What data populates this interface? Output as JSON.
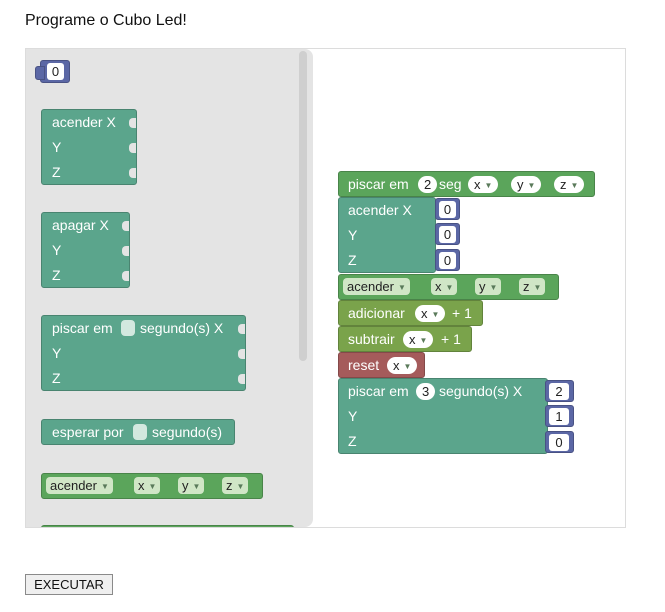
{
  "page": {
    "title": "Programe o Cubo Led!"
  },
  "flyout": {
    "number": "0",
    "acender": {
      "line1": "acender X",
      "line2": "Y",
      "line3": "Z"
    },
    "apagar": {
      "line1": "apagar X",
      "line2": "Y",
      "line3": "Z"
    },
    "piscar": {
      "pre": "piscar em",
      "post": "segundo(s) X",
      "line2": "Y",
      "line3": "Z"
    },
    "esperar": {
      "pre": "esperar por",
      "post": "segundo(s)"
    },
    "acender_dd": {
      "label": "acender",
      "x": "x",
      "y": "y",
      "z": "z"
    }
  },
  "canvas": {
    "piscar_seg": {
      "pre": "piscar em",
      "num": "2",
      "post": "seg",
      "x": "x",
      "y": "y",
      "z": "z"
    },
    "acender": {
      "line1": "acender X",
      "line2": "Y",
      "line3": "Z",
      "x": "0",
      "y": "0",
      "z": "0"
    },
    "acender_dd": {
      "label": "acender",
      "x": "x",
      "y": "y",
      "z": "z"
    },
    "adicionar": {
      "label": "adicionar",
      "var": "x",
      "suffix": "+ 1"
    },
    "subtrair": {
      "label": "subtrair",
      "var": "x",
      "suffix": "+ 1"
    },
    "reset": {
      "label": "reset",
      "var": "x"
    },
    "piscar": {
      "pre": "piscar em",
      "num": "3",
      "post": "segundo(s) X",
      "line2": "Y",
      "line3": "Z",
      "x": "2",
      "y": "1",
      "z": "0"
    }
  },
  "execute_button": "EXECUTAR"
}
